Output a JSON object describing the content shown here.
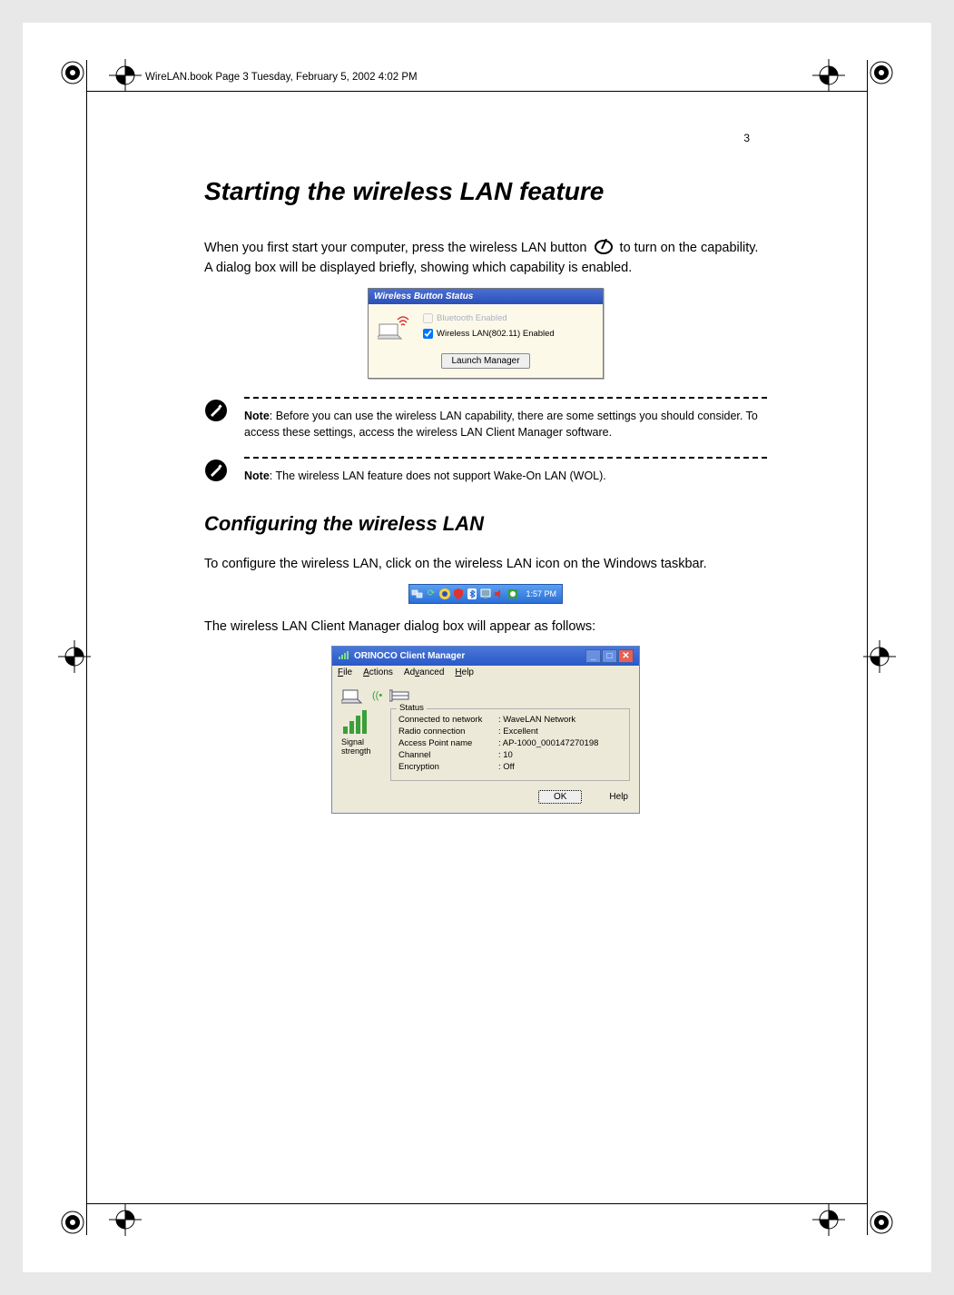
{
  "header_line": "WireLAN.book  Page 3  Tuesday, February 5, 2002  4:02 PM",
  "page_number": "3",
  "h1": "Starting the wireless LAN feature",
  "intro_a": "When you first start your computer, press the wireless LAN button ",
  "intro_b": " to turn on the capability.  A dialog box will be displayed briefly, showing which capability is enabled.",
  "dlg_status": {
    "title": "Wireless Button Status",
    "opt_bt": "Bluetooth Enabled",
    "opt_wlan": "Wireless LAN(802.11) Enabled",
    "launch_btn": "Launch Manager"
  },
  "note1": {
    "label": "Note",
    "text": ": Before you can use the wireless LAN capability, there are some settings you should consider.  To access these settings, access the wireless LAN Client Manager software."
  },
  "note2": {
    "label": "Note",
    "text": ": The wireless LAN feature does not support Wake-On LAN (WOL)."
  },
  "h2": "Configuring the wireless LAN",
  "cfg_intro": "To configure the wireless LAN, click on the wireless LAN icon on the Windows taskbar.",
  "tray_time": "1:57 PM",
  "cfg_followup": "The wireless LAN Client Manager dialog box will appear as follows:",
  "dlg_cm": {
    "title": "ORINOCO Client Manager",
    "menus": [
      "File",
      "Actions",
      "Advanced",
      "Help"
    ],
    "signal_label": "Signal strength",
    "group_label": "Status",
    "rows": [
      {
        "k": "Connected to network",
        "v": ": WaveLAN Network"
      },
      {
        "k": "Radio connection",
        "v": ": Excellent"
      },
      {
        "k": "Access Point name",
        "v": ": AP-1000_000147270198"
      },
      {
        "k": "Channel",
        "v": ": 10"
      },
      {
        "k": "Encryption",
        "v": ": Off"
      }
    ],
    "ok": "OK",
    "help": "Help"
  }
}
